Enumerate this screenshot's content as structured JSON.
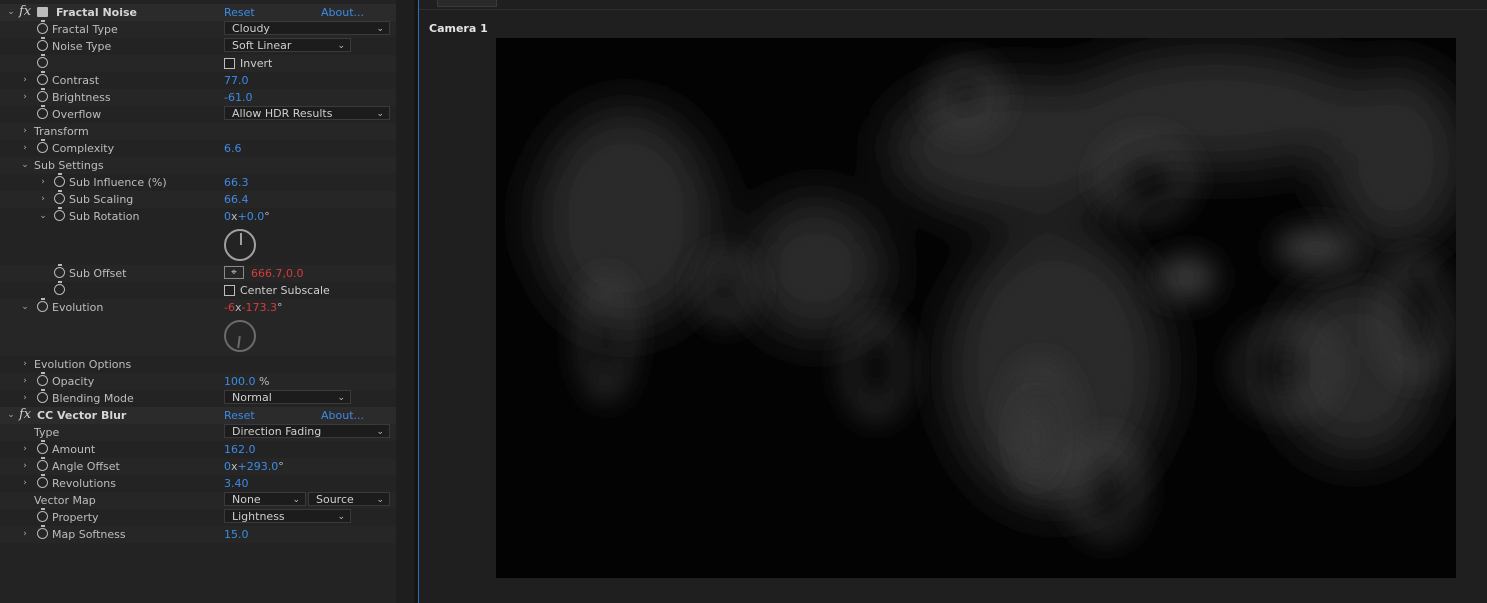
{
  "effects": [
    {
      "name": "Fractal Noise",
      "reset": "Reset",
      "about": "About...",
      "properties": {
        "fractal_type": {
          "label": "Fractal Type",
          "value": "Cloudy"
        },
        "noise_type": {
          "label": "Noise Type",
          "value": "Soft Linear"
        },
        "invert": {
          "label": "Invert",
          "checked": false
        },
        "contrast": {
          "label": "Contrast",
          "value": "77.0"
        },
        "brightness": {
          "label": "Brightness",
          "value": "-61.0"
        },
        "overflow": {
          "label": "Overflow",
          "value": "Allow HDR Results"
        },
        "transform": {
          "label": "Transform"
        },
        "complexity": {
          "label": "Complexity",
          "value": "6.6"
        },
        "sub_settings": {
          "label": "Sub Settings"
        },
        "sub_influence": {
          "label": "Sub Influence (%)",
          "value": "66.3"
        },
        "sub_scaling": {
          "label": "Sub Scaling",
          "value": "66.4"
        },
        "sub_rotation": {
          "label": "Sub Rotation",
          "revolutions": "0",
          "x_sep": "x",
          "degrees": "+0.0",
          "deg_sign": "°"
        },
        "sub_offset": {
          "label": "Sub Offset",
          "value": "666.7,0.0"
        },
        "center_subscale": {
          "label": "Center Subscale",
          "checked": false
        },
        "evolution": {
          "label": "Evolution",
          "revolutions": "-6",
          "x_sep": "x",
          "degrees": "-173.3",
          "deg_sign": "°"
        },
        "evolution_options": {
          "label": "Evolution Options"
        },
        "opacity": {
          "label": "Opacity",
          "value": "100.0",
          "unit": "%"
        },
        "blending_mode": {
          "label": "Blending Mode",
          "value": "Normal"
        }
      }
    },
    {
      "name": "CC Vector Blur",
      "reset": "Reset",
      "about": "About...",
      "properties": {
        "type": {
          "label": "Type",
          "value": "Direction Fading"
        },
        "amount": {
          "label": "Amount",
          "value": "162.0"
        },
        "angle_offset": {
          "label": "Angle Offset",
          "revolutions": "0",
          "x_sep": "x",
          "degrees": "+293.0",
          "deg_sign": "°"
        },
        "revolutions": {
          "label": "Revolutions",
          "value": "3.40"
        },
        "vector_map": {
          "label": "Vector Map",
          "layer": "None",
          "source": "Source"
        },
        "property": {
          "label": "Property",
          "value": "Lightness"
        },
        "map_softness": {
          "label": "Map Softness",
          "value": "15.0"
        }
      }
    }
  ],
  "viewer": {
    "camera_label": "Camera 1"
  },
  "colors": {
    "value_blue": "#3d8be5",
    "keyframed_red": "#d63c3c",
    "panel_bg": "#232323",
    "comp_bg": "#030303"
  }
}
